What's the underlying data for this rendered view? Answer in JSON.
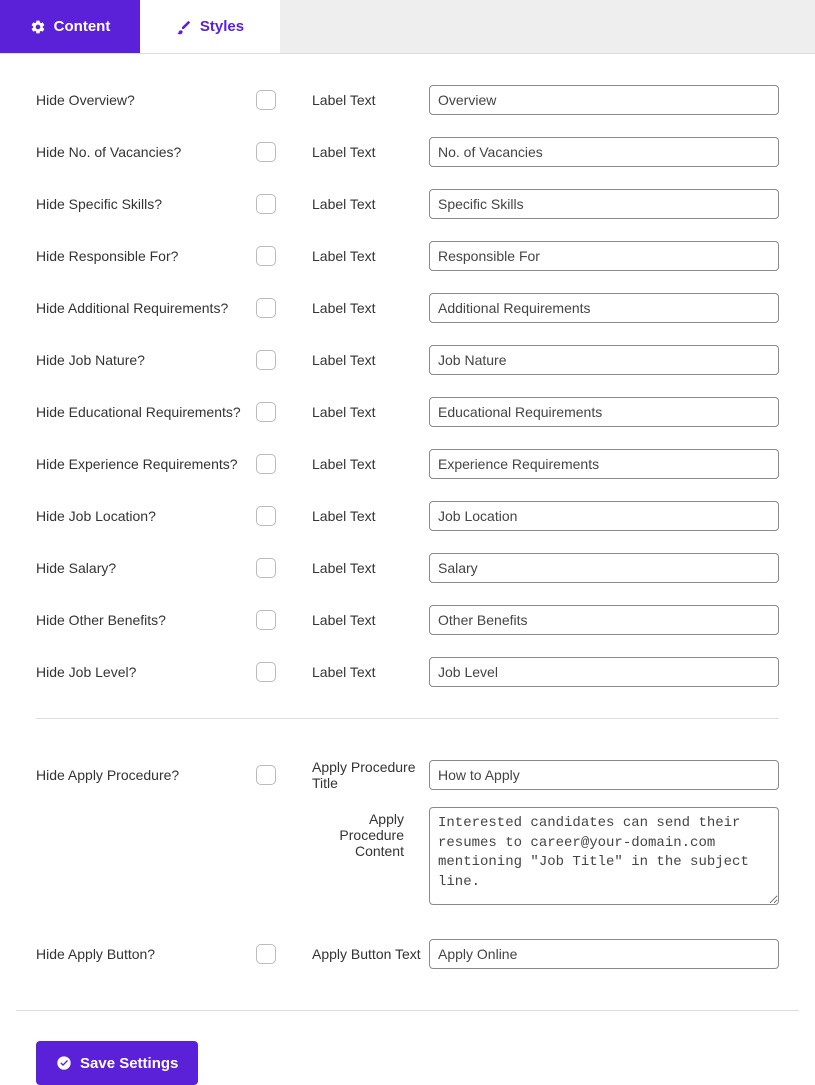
{
  "tabs": {
    "content": "Content",
    "styles": "Styles"
  },
  "labelTextLabel": "Label Text",
  "fields": {
    "overview": {
      "hide": "Hide Overview?",
      "value": "Overview"
    },
    "vacancies": {
      "hide": "Hide No. of Vacancies?",
      "value": "No. of Vacancies"
    },
    "skills": {
      "hide": "Hide Specific Skills?",
      "value": "Specific Skills"
    },
    "responsible": {
      "hide": "Hide Responsible For?",
      "value": "Responsible For"
    },
    "additional": {
      "hide": "Hide Additional Requirements?",
      "value": "Additional Requirements"
    },
    "nature": {
      "hide": "Hide Job Nature?",
      "value": "Job Nature"
    },
    "education": {
      "hide": "Hide Educational Requirements?",
      "value": "Educational Requirements"
    },
    "experience": {
      "hide": "Hide Experience Requirements?",
      "value": "Experience Requirements"
    },
    "location": {
      "hide": "Hide Job Location?",
      "value": "Job Location"
    },
    "salary": {
      "hide": "Hide Salary?",
      "value": "Salary"
    },
    "benefits": {
      "hide": "Hide Other Benefits?",
      "value": "Other Benefits"
    },
    "level": {
      "hide": "Hide Job Level?",
      "value": "Job Level"
    }
  },
  "apply": {
    "hideProcedure": "Hide Apply Procedure?",
    "procedureTitleLabel": "Apply Procedure Title",
    "procedureTitleValue": "How to Apply",
    "procedureContentLabel": "Apply Procedure Content",
    "procedureContentValue": "Interested candidates can send their resumes to career@your-domain.com mentioning \"Job Title\" in the subject line.",
    "hideButton": "Hide Apply Button?",
    "buttonTextLabel": "Apply Button Text",
    "buttonTextValue": "Apply Online"
  },
  "saveLabel": "Save Settings"
}
